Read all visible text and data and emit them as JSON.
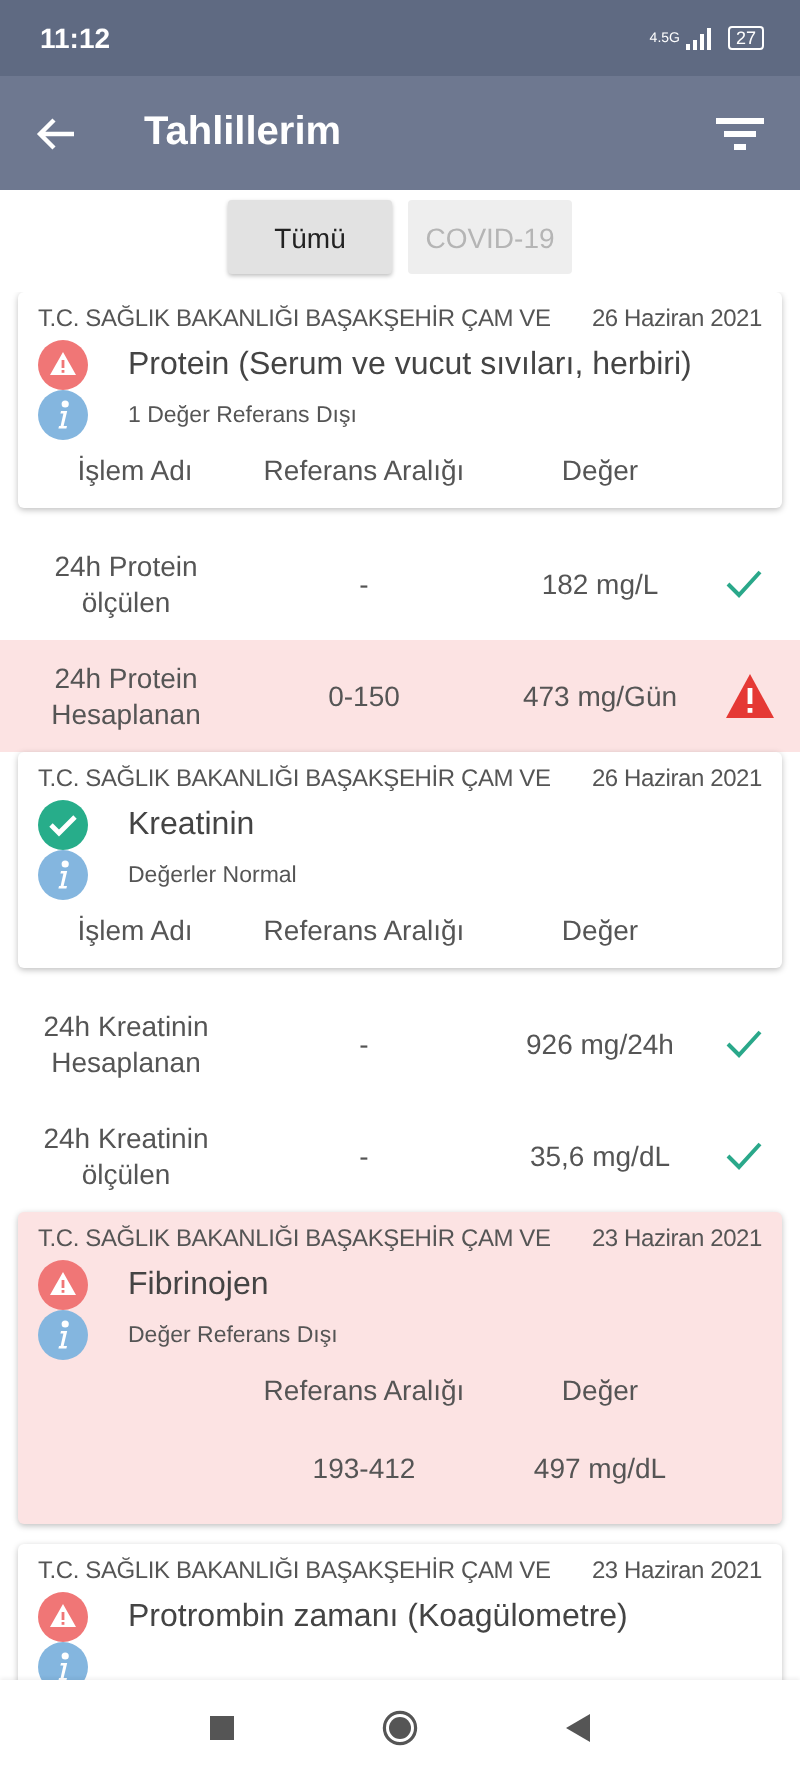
{
  "status_bar": {
    "time": "11:12",
    "network": "4.5G",
    "battery": "27"
  },
  "app_bar": {
    "title": "Tahlillerim"
  },
  "filters": [
    {
      "label": "Tümü",
      "selected": true
    },
    {
      "label": "COVID-19",
      "selected": false
    }
  ],
  "tests": [
    {
      "institution": "T.C. SAĞLIK BAKANLIĞI BAŞAKŞEHİR ÇAM VE",
      "date": "26 Haziran 2021",
      "out_of_range": true,
      "title": "Protein (Serum ve vucut sıvıları, herbiri)",
      "note": "1 Değer Referans Dışı",
      "highlighted": false,
      "results_inside": false,
      "columns": [
        {
          "kind": "name",
          "label": "İşlem Adı"
        },
        {
          "kind": "range",
          "label": "Referans Aralığı"
        },
        {
          "kind": "value",
          "label": "Değer"
        }
      ],
      "results": [
        {
          "name": "24h Protein ölçülen",
          "range": "-",
          "value": "182 mg/L",
          "out_of_range": false
        },
        {
          "name": "24h Protein Hesaplanan",
          "range": "0-150",
          "value": "473 mg/Gün",
          "out_of_range": true
        }
      ]
    },
    {
      "institution": "T.C. SAĞLIK BAKANLIĞI BAŞAKŞEHİR ÇAM VE",
      "date": "26 Haziran 2021",
      "out_of_range": false,
      "title": "Kreatinin",
      "note": "Değerler Normal",
      "highlighted": false,
      "results_inside": false,
      "columns": [
        {
          "kind": "name",
          "label": "İşlem Adı"
        },
        {
          "kind": "range",
          "label": "Referans Aralığı"
        },
        {
          "kind": "value",
          "label": "Değer"
        }
      ],
      "results": [
        {
          "name": "24h Kreatinin Hesaplanan",
          "range": "-",
          "value": "926 mg/24h",
          "out_of_range": false
        },
        {
          "name": "24h Kreatinin ölçülen",
          "range": "-",
          "value": "35,6 mg/dL",
          "out_of_range": false
        }
      ]
    },
    {
      "institution": "T.C. SAĞLIK BAKANLIĞI BAŞAKŞEHİR ÇAM VE",
      "date": "23 Haziran 2021",
      "out_of_range": true,
      "title": "Fibrinojen",
      "note": "Değer Referans Dışı",
      "highlighted": true,
      "results_inside": true,
      "columns": [
        {
          "kind": "range",
          "label": "Referans Aralığı"
        },
        {
          "kind": "value",
          "label": "Değer"
        }
      ],
      "results": [
        {
          "range": "193-412",
          "value": "497 mg/dL"
        }
      ]
    },
    {
      "institution": "T.C. SAĞLIK BAKANLIĞI BAŞAKŞEHİR ÇAM VE",
      "date": "23 Haziran 2021",
      "out_of_range": true,
      "title": "Protrombin zamanı (Koagülometre)",
      "highlighted": false,
      "results_inside": false
    }
  ]
}
